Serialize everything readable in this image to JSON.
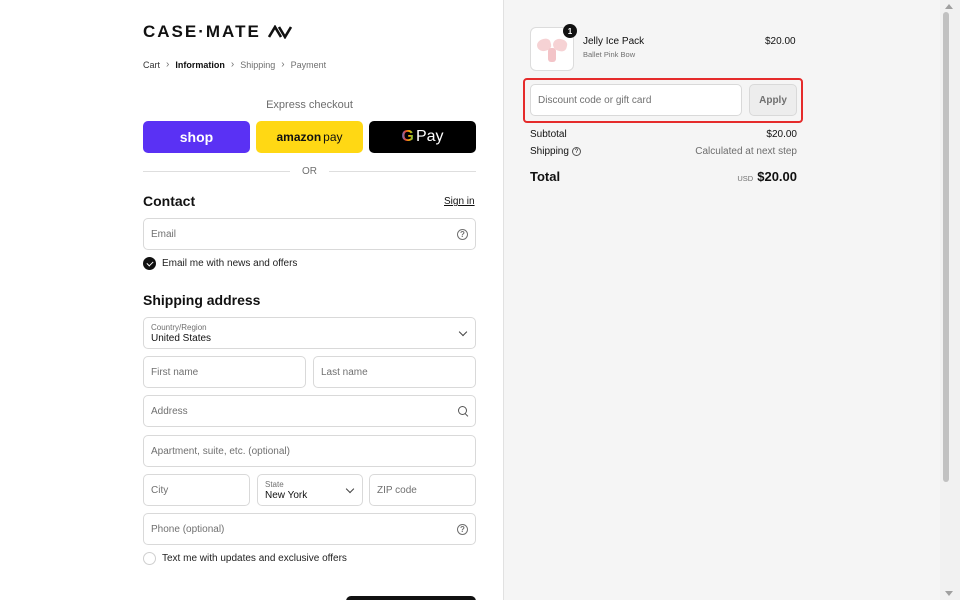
{
  "brand": {
    "logo_text": "CASE·MATE"
  },
  "breadcrumb": {
    "cart": "Cart",
    "information": "Information",
    "shipping": "Shipping",
    "payment": "Payment"
  },
  "express": {
    "label": "Express checkout",
    "shop": "shop",
    "amazon_a": "amazon",
    "amazon_b": "pay",
    "gpay": "Pay",
    "or": "OR"
  },
  "contact": {
    "title": "Contact",
    "signin": "Sign in",
    "email_placeholder": "Email",
    "news_label": "Email me with news and offers",
    "news_checked": true
  },
  "shipping": {
    "title": "Shipping address",
    "country_label": "Country/Region",
    "country_value": "United States",
    "first_name": "First name",
    "last_name": "Last name",
    "address": "Address",
    "apartment": "Apartment, suite, etc. (optional)",
    "city": "City",
    "state_label": "State",
    "state_value": "New York",
    "zip": "ZIP code",
    "phone": "Phone (optional)",
    "sms_label": "Text me with updates and exclusive offers"
  },
  "order": {
    "quantity": "1",
    "product_name": "Jelly Ice Pack",
    "product_variant": "Ballet Pink Bow",
    "product_price": "$20.00",
    "discount_placeholder": "Discount code or gift card",
    "apply": "Apply",
    "subtotal_label": "Subtotal",
    "subtotal_value": "$20.00",
    "shipping_label": "Shipping",
    "shipping_value": "Calculated at next step",
    "total_label": "Total",
    "currency": "USD",
    "total_value": "$20.00"
  },
  "colors": {
    "shop": "#5a31f4",
    "amazon": "#ffd814",
    "gpay": "#000000",
    "highlight": "#e52b2b"
  }
}
